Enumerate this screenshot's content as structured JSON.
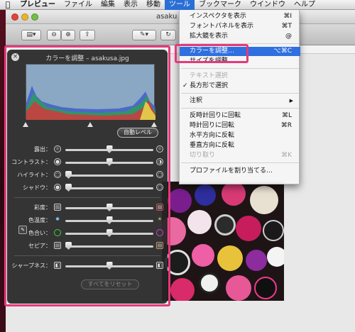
{
  "menubar": {
    "apple": "",
    "items": [
      "プレビュー",
      "ファイル",
      "編集",
      "表示",
      "移動",
      "ツール",
      "ブックマーク",
      "ウインドウ",
      "ヘルプ"
    ]
  },
  "window": {
    "title": "asakusa.jpg",
    "title_partial": "asaku"
  },
  "tools_menu": {
    "items": [
      {
        "label": "インスペクタを表示",
        "shortcut": "⌘I"
      },
      {
        "label": "フォントパネルを表示",
        "shortcut": "⌘T"
      },
      {
        "label": "拡大鏡を表示",
        "shortcut": "@"
      },
      {
        "label": "カラーを調整…",
        "shortcut": "⌥⌘C"
      },
      {
        "label": "サイズを調整…",
        "shortcut": ""
      },
      {
        "label": "テキスト選択",
        "shortcut": ""
      },
      {
        "label": "長方形で選択",
        "shortcut": "",
        "checked": true
      },
      {
        "label": "注釈",
        "shortcut": ""
      },
      {
        "label": "反時計回りに回転",
        "shortcut": "⌘L"
      },
      {
        "label": "時計回りに回転",
        "shortcut": "⌘R"
      },
      {
        "label": "水平方向に反転",
        "shortcut": ""
      },
      {
        "label": "垂直方向に反転",
        "shortcut": ""
      },
      {
        "label": "切り取り",
        "shortcut": "⌘K"
      },
      {
        "label": "プロファイルを割り当てる…",
        "shortcut": ""
      }
    ],
    "check_mark": "✓",
    "submenu_arrow": "▶"
  },
  "adjust_panel": {
    "title": "カラーを調整 – asakusa.jpg",
    "close": "×",
    "auto_levels": "自動レベル",
    "sliders": [
      {
        "label": "露出：",
        "value": 0.5
      },
      {
        "label": "コントラスト：",
        "value": 0.5
      },
      {
        "label": "ハイライト：",
        "value": 0.0
      },
      {
        "label": "シャドウ：",
        "value": 0.0
      },
      {
        "label": "彩度：",
        "value": 0.5
      },
      {
        "label": "色温度：",
        "value": 0.5
      },
      {
        "label": "色合い：",
        "value": 0.5
      },
      {
        "label": "セピア：",
        "value": 0.0
      },
      {
        "label": "シャープネス：",
        "value": 0.5
      }
    ],
    "reset_all": "すべてをリセット"
  },
  "colors": {
    "highlight": "#e33a7a",
    "menu_selection": "#2f6fe0"
  }
}
